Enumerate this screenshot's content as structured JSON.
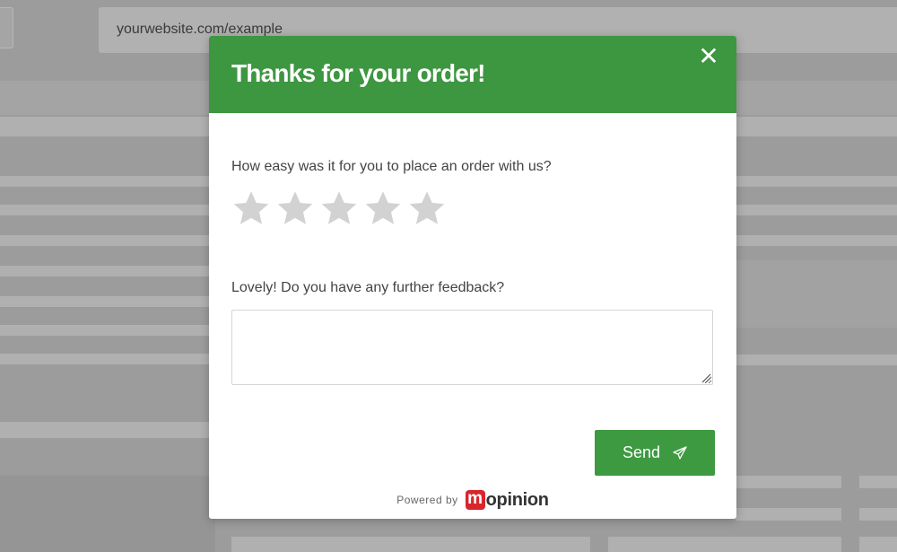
{
  "browser": {
    "url": "yourwebsite.com/example"
  },
  "modal": {
    "title": "Thanks for your order!",
    "close_symbol": "✕",
    "header_color": "#3d9640",
    "question_1": "How easy was it for you to place an order with us?",
    "rating": {
      "max": 5,
      "selected": 0,
      "star_color": "#d2d2d2"
    },
    "question_2": "Lovely! Do you have any further feedback?",
    "feedback_value": "",
    "send_label": "Send",
    "send_icon": "paper-plane-icon",
    "send_color": "#3d9a41"
  },
  "footer": {
    "powered_by": "Powered by",
    "brand_initial": "m",
    "brand_rest": "opinion",
    "brand_color": "#d8262c"
  }
}
